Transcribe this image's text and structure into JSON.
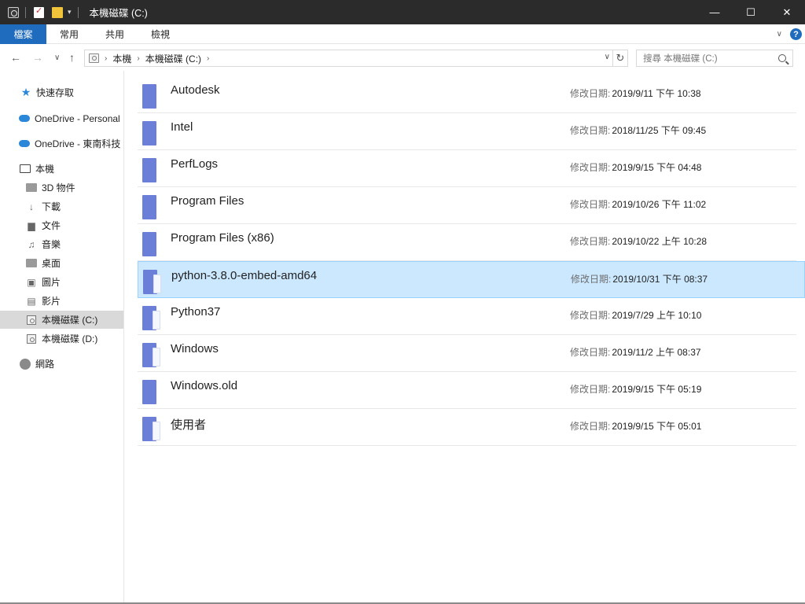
{
  "window": {
    "title": "本機磁碟 (C:)",
    "minimize_glyph": "—",
    "maximize_glyph": "☐",
    "close_glyph": "✕",
    "dropdown_glyph": "▾"
  },
  "ribbon": {
    "tabs": [
      "檔案",
      "常用",
      "共用",
      "檢視"
    ],
    "help_glyph": "?",
    "expand_glyph": "∨"
  },
  "nav": {
    "back_glyph": "←",
    "forward_glyph": "→",
    "recent_glyph": "∨",
    "up_glyph": "↑",
    "crumbs": [
      "本機",
      "本機磁碟 (C:)"
    ],
    "crumb_sep": "›",
    "address_dropdown_glyph": "∨",
    "refresh_glyph": "↻",
    "search_placeholder": "搜尋 本機磁碟 (C:)"
  },
  "sidebar": {
    "items": [
      {
        "label": "快速存取",
        "icon": "star-icon"
      },
      {
        "label": "OneDrive - Personal",
        "icon": "cloud-icon"
      },
      {
        "label": "OneDrive - 東南科技",
        "icon": "cloud-icon"
      },
      {
        "label": "本機",
        "icon": "computer-icon"
      },
      {
        "label": "3D 物件",
        "icon": "folder-icon"
      },
      {
        "label": "下載",
        "icon": "download-icon"
      },
      {
        "label": "文件",
        "icon": "document-icon"
      },
      {
        "label": "音樂",
        "icon": "music-icon"
      },
      {
        "label": "桌面",
        "icon": "desktop-icon"
      },
      {
        "label": "圖片",
        "icon": "picture-icon"
      },
      {
        "label": "影片",
        "icon": "video-icon"
      },
      {
        "label": "本機磁碟 (C:)",
        "icon": "drive-icon",
        "selected": true
      },
      {
        "label": "本機磁碟 (D:)",
        "icon": "drive-icon"
      },
      {
        "label": "網路",
        "icon": "network-icon"
      }
    ]
  },
  "files": {
    "meta_label": "修改日期:",
    "items": [
      {
        "name": "Autodesk",
        "modified": "2019/9/11 下午 10:38"
      },
      {
        "name": "Intel",
        "modified": "2018/11/25 下午 09:45"
      },
      {
        "name": "PerfLogs",
        "modified": "2019/9/15 下午 04:48"
      },
      {
        "name": "Program Files",
        "modified": "2019/10/26 下午 11:02"
      },
      {
        "name": "Program Files (x86)",
        "modified": "2019/10/22 上午 10:28"
      },
      {
        "name": "python-3.8.0-embed-amd64",
        "modified": "2019/10/31 下午 08:37",
        "selected": true
      },
      {
        "name": "Python37",
        "modified": "2019/7/29 上午 10:10"
      },
      {
        "name": "Windows",
        "modified": "2019/11/2 上午 08:37"
      },
      {
        "name": "Windows.old",
        "modified": "2019/9/15 下午 05:19"
      },
      {
        "name": "使用者",
        "modified": "2019/9/15 下午 05:01"
      }
    ]
  },
  "colors": {
    "titlebar": "#2b2b2b",
    "file_tab": "#1f6bbd",
    "selection": "#cce8ff",
    "folder": "#6c7fd8"
  }
}
